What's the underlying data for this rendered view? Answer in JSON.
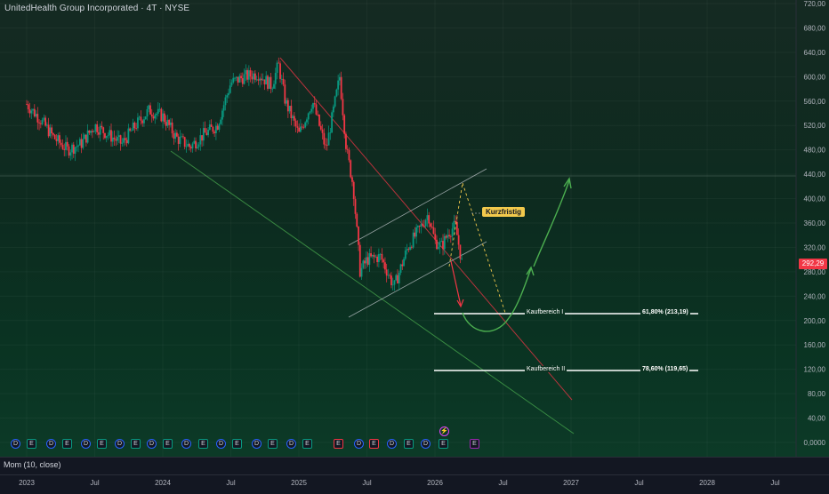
{
  "title": "UnitedHealth Group Incorporated · 4T · NYSE",
  "price_axis": [
    "720,00",
    "680,00",
    "640,00",
    "600,00",
    "560,00",
    "520,00",
    "480,00",
    "440,00",
    "400,00",
    "360,00",
    "320,00",
    "280,00",
    "240,00",
    "200,00",
    "160,00",
    "120,00",
    "80,00",
    "40,00",
    "0,0000"
  ],
  "current_price": "292,29",
  "time_axis": [
    "2023",
    "Jul",
    "2024",
    "Jul",
    "2025",
    "Jul",
    "2026",
    "Jul",
    "2027",
    "Jul",
    "2028",
    "Jul"
  ],
  "indicator_label": "Mom (10, close)",
  "annotations": {
    "short_term": "Kurzfristig",
    "buy_zone_1": "Kaufbereich I",
    "fib_618": "61,80% (213,19)",
    "buy_zone_2": "Kaufbereich II",
    "fib_786": "78,60% (119,65)"
  },
  "events": [
    "D",
    "E",
    "D",
    "E",
    "D",
    "E",
    "D",
    "E",
    "D",
    "E",
    "D",
    "E",
    "D",
    "E",
    "D",
    "E",
    "D",
    "E",
    "E",
    "D",
    "E",
    "D",
    "E",
    "D",
    "E",
    "E",
    "E"
  ],
  "colors": {
    "up": "#089981",
    "down": "#f23645",
    "channel": "#d1d4dc",
    "target": "#4caf50",
    "label_bg": "#f2c94c"
  },
  "chart_data": {
    "type": "line",
    "ticker": "UNH",
    "timeframe": "4T",
    "ylim": [
      0,
      720
    ],
    "series": [
      {
        "values": [
          [
            2023.0,
            555
          ],
          [
            2023.1,
            530
          ],
          [
            2023.2,
            500
          ],
          [
            2023.3,
            480
          ],
          [
            2023.4,
            490
          ],
          [
            2023.5,
            520
          ],
          [
            2023.6,
            505
          ],
          [
            2023.7,
            490
          ],
          [
            2023.8,
            520
          ],
          [
            2023.9,
            545
          ],
          [
            2024.0,
            535
          ],
          [
            2024.1,
            500
          ],
          [
            2024.2,
            485
          ],
          [
            2024.3,
            505
          ],
          [
            2024.4,
            520
          ],
          [
            2024.5,
            590
          ],
          [
            2024.6,
            600
          ],
          [
            2024.7,
            605
          ],
          [
            2024.8,
            585
          ],
          [
            2024.85,
            620
          ],
          [
            2024.9,
            560
          ],
          [
            2025.0,
            505
          ],
          [
            2025.1,
            560
          ],
          [
            2025.2,
            480
          ],
          [
            2025.3,
            600
          ],
          [
            2025.35,
            480
          ],
          [
            2025.4,
            420
          ],
          [
            2025.45,
            280
          ],
          [
            2025.5,
            300
          ],
          [
            2025.6,
            305
          ],
          [
            2025.7,
            255
          ],
          [
            2025.8,
            320
          ],
          [
            2025.9,
            355
          ],
          [
            2025.95,
            375
          ],
          [
            2026.0,
            330
          ],
          [
            2026.05,
            322
          ],
          [
            2026.1,
            345
          ],
          [
            2026.15,
            356
          ],
          [
            2026.2,
            292
          ]
        ]
      }
    ],
    "horizontal_levels": [
      {
        "label": "61,80% (213,19)",
        "value": 213.19
      },
      {
        "label": "78,60% (119,65)",
        "value": 119.65
      }
    ]
  }
}
